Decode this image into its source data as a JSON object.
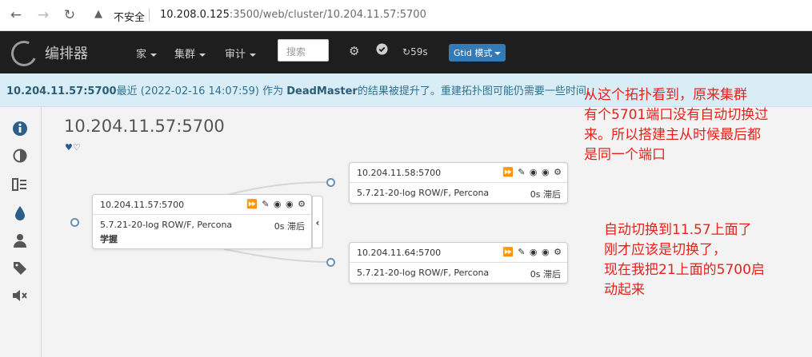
{
  "browser": {
    "security_label": "不安全",
    "url_host": "10.208.0.125",
    "url_rest": ":3500/web/cluster/10.204.11.57:5700"
  },
  "navbar": {
    "brand": "编排器",
    "menu": [
      "家",
      "集群",
      "审计"
    ],
    "search_placeholder": "搜索",
    "refresh_label": "59s",
    "gtid_label": "Gtid 模式"
  },
  "alert": {
    "host": "10.204.11.57:5700",
    "text1": "最近 (2022-02-16 14:07:59) 作为",
    "role": "DeadMaster",
    "text2": "的结果被提升了。重建拓扑图可能仍需要一些时间。"
  },
  "cluster": {
    "title": "10.204.11.57:5700",
    "hearts": "♥♡"
  },
  "nodes": {
    "master": {
      "host": "10.204.11.57:5700",
      "version": "5.7.21-20-log ROW/F,  Percona",
      "lag": "0s 滞后",
      "extra": "学握"
    },
    "replica1": {
      "host": "10.204.11.58:5700",
      "version": "5.7.21-20-log ROW/F,  Percona",
      "lag": "0s 滞后"
    },
    "replica2": {
      "host": "10.204.11.64:5700",
      "version": "5.7.21-20-log ROW/F,  Percona",
      "lag": "0s 滞后"
    }
  },
  "annotations": {
    "top": "从这个拓扑看到，原来集群\n有个5701端口没有自动切换过\n来。所以搭建主从时候最后都\n是同一个端口",
    "bottom": "自动切换到11.57上面了\n刚才应该是切换了，\n现在我把21上面的5700启\n动起来"
  }
}
